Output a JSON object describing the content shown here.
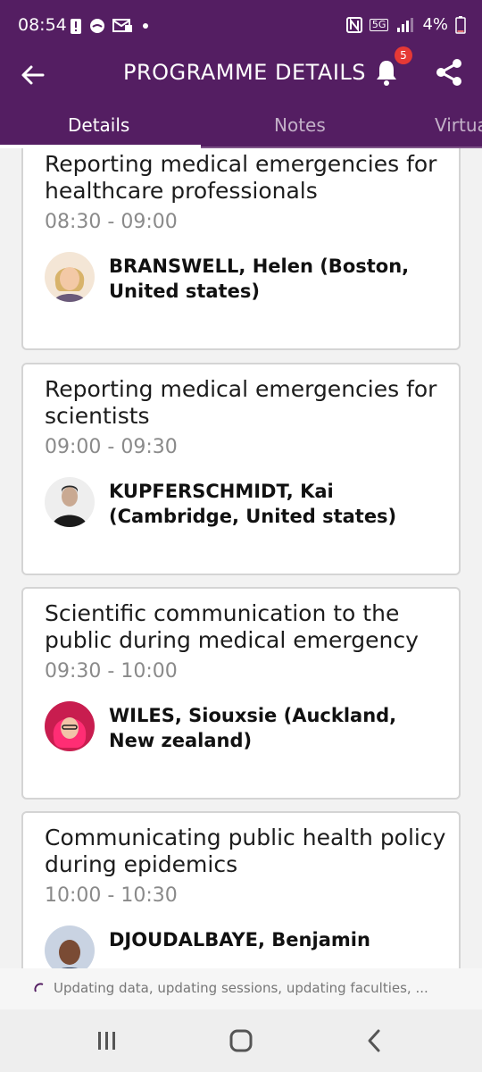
{
  "status": {
    "time": "08:54",
    "battery": "4%",
    "network": "5G",
    "left_icons": [
      "alert-icon",
      "messenger-icon",
      "mail-icon",
      "dot-icon"
    ],
    "right_icons": [
      "nfc-icon",
      "5g-icon",
      "signal-icon",
      "battery-icon"
    ]
  },
  "header": {
    "title": "PROGRAMME DETAILS",
    "notification_count": "5",
    "icons": [
      "back-arrow-icon",
      "bell-icon",
      "share-icon"
    ]
  },
  "tabs": [
    {
      "label": "Details",
      "active": true
    },
    {
      "label": "Notes",
      "active": false
    },
    {
      "label": "Virtua",
      "active": false
    }
  ],
  "sessions": [
    {
      "title": "Reporting medical emergencies for healthcare professionals",
      "time": "08:30 - 09:00",
      "speaker": "BRANSWELL, Helen (Boston, United states)"
    },
    {
      "title": "Reporting medical emergencies for scientists",
      "time": "09:00 - 09:30",
      "speaker": "KUPFERSCHMIDT, Kai (Cambridge, United states)"
    },
    {
      "title": "Scientific communication to the public during medical emergency",
      "time": "09:30 - 10:00",
      "speaker": "WILES, Siouxsie (Auckland, New zealand)"
    },
    {
      "title": "Communicating public health policy during epidemics",
      "time": "10:00 - 10:30",
      "speaker": "DJOUDALBAYE, Benjamin"
    }
  ],
  "loading": {
    "text": "Updating data, updating sessions, updating faculties, ..."
  },
  "colors": {
    "brand": "#541e62",
    "badge": "#e53935"
  },
  "nav": [
    "recent-apps-icon",
    "home-icon",
    "back-icon"
  ]
}
